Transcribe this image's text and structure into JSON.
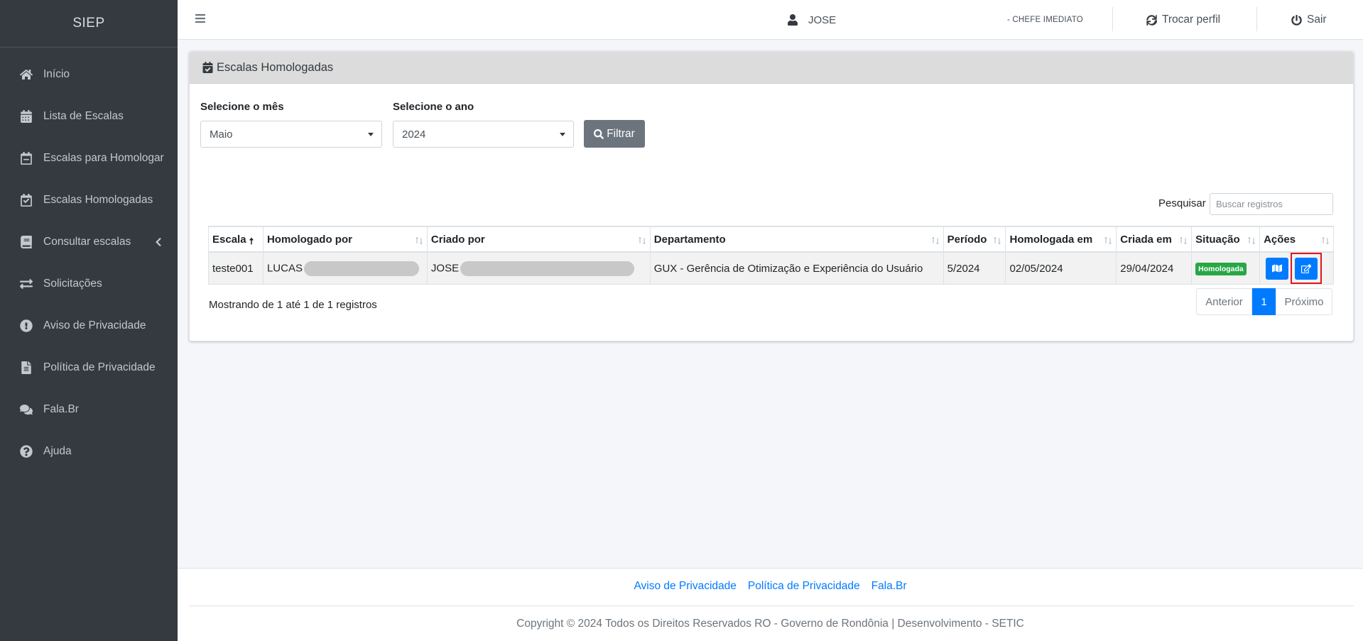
{
  "sidebar": {
    "brand": "SIEP",
    "items": [
      {
        "label": "Início",
        "icon": "home-icon"
      },
      {
        "label": "Lista de Escalas",
        "icon": "table-icon"
      },
      {
        "label": "Escalas para Homologar",
        "icon": "calendar-minus-icon"
      },
      {
        "label": "Escalas Homologadas",
        "icon": "calendar-check-icon"
      },
      {
        "label": "Consultar escalas",
        "icon": "book-icon"
      },
      {
        "label": "Solicitações",
        "icon": "exchange-icon"
      },
      {
        "label": "Aviso de Privacidade",
        "icon": "exclamation-circle-icon"
      },
      {
        "label": "Política de Privacidade",
        "icon": "file-icon"
      },
      {
        "label": "Fala.Br",
        "icon": "comments-icon"
      },
      {
        "label": "Ajuda",
        "icon": "question-circle-icon"
      }
    ]
  },
  "topbar": {
    "user_name": "JOSE",
    "role": "- CHEFE IMEDIATO",
    "switch_profile": "Trocar perfil",
    "logout": "Sair"
  },
  "card": {
    "title": "Escalas Homologadas",
    "month_label": "Selecione o mês",
    "month_value": "Maio",
    "year_label": "Selecione o ano",
    "year_value": "2024",
    "filter_button": "Filtrar",
    "search_label": "Pesquisar",
    "search_placeholder": "Buscar registros"
  },
  "table": {
    "headers": [
      "Escala",
      "Homologado por",
      "Criado por",
      "Departamento",
      "Período",
      "Homologada em",
      "Criada em",
      "Situação",
      "Ações"
    ],
    "rows": [
      {
        "escala": "teste001",
        "homologado_por": "LUCAS",
        "criado_por": "JOSE",
        "departamento": "GUX - Gerência de Otimização e Experiência do Usuário",
        "periodo": "5/2024",
        "homologada_em": "02/05/2024",
        "criada_em": "29/04/2024",
        "situacao": "Homologada"
      }
    ]
  },
  "pagination": {
    "info": "Mostrando de 1 até 1 de 1 registros",
    "prev": "Anterior",
    "page": "1",
    "next": "Próximo"
  },
  "footer": {
    "links": [
      "Aviso de Privacidade",
      "Política de Privacidade",
      "Fala.Br"
    ],
    "copyright": "Copyright © 2024 Todos os Direitos Reservados RO - Governo de Rondônia | Desenvolvimento - SETIC"
  },
  "colors": {
    "sidebar_bg": "#343a40",
    "primary": "#007bff",
    "success": "#28a745",
    "secondary": "#6c757d",
    "highlight": "#e3141e"
  }
}
